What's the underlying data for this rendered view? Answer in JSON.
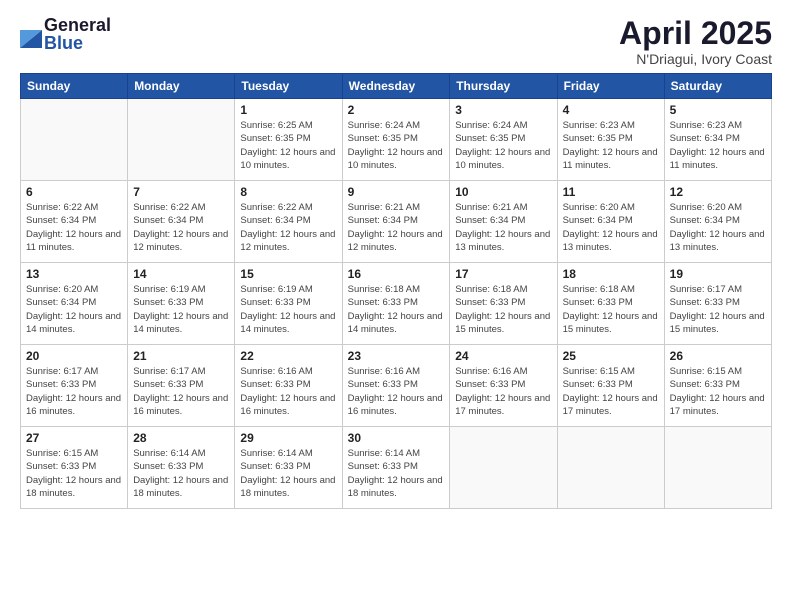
{
  "logo": {
    "general": "General",
    "blue": "Blue"
  },
  "header": {
    "title": "April 2025",
    "subtitle": "N'Driagui, Ivory Coast"
  },
  "weekdays": [
    "Sunday",
    "Monday",
    "Tuesday",
    "Wednesday",
    "Thursday",
    "Friday",
    "Saturday"
  ],
  "weeks": [
    [
      {
        "day": "",
        "info": ""
      },
      {
        "day": "",
        "info": ""
      },
      {
        "day": "1",
        "info": "Sunrise: 6:25 AM\nSunset: 6:35 PM\nDaylight: 12 hours and 10 minutes."
      },
      {
        "day": "2",
        "info": "Sunrise: 6:24 AM\nSunset: 6:35 PM\nDaylight: 12 hours and 10 minutes."
      },
      {
        "day": "3",
        "info": "Sunrise: 6:24 AM\nSunset: 6:35 PM\nDaylight: 12 hours and 10 minutes."
      },
      {
        "day": "4",
        "info": "Sunrise: 6:23 AM\nSunset: 6:35 PM\nDaylight: 12 hours and 11 minutes."
      },
      {
        "day": "5",
        "info": "Sunrise: 6:23 AM\nSunset: 6:34 PM\nDaylight: 12 hours and 11 minutes."
      }
    ],
    [
      {
        "day": "6",
        "info": "Sunrise: 6:22 AM\nSunset: 6:34 PM\nDaylight: 12 hours and 11 minutes."
      },
      {
        "day": "7",
        "info": "Sunrise: 6:22 AM\nSunset: 6:34 PM\nDaylight: 12 hours and 12 minutes."
      },
      {
        "day": "8",
        "info": "Sunrise: 6:22 AM\nSunset: 6:34 PM\nDaylight: 12 hours and 12 minutes."
      },
      {
        "day": "9",
        "info": "Sunrise: 6:21 AM\nSunset: 6:34 PM\nDaylight: 12 hours and 12 minutes."
      },
      {
        "day": "10",
        "info": "Sunrise: 6:21 AM\nSunset: 6:34 PM\nDaylight: 12 hours and 13 minutes."
      },
      {
        "day": "11",
        "info": "Sunrise: 6:20 AM\nSunset: 6:34 PM\nDaylight: 12 hours and 13 minutes."
      },
      {
        "day": "12",
        "info": "Sunrise: 6:20 AM\nSunset: 6:34 PM\nDaylight: 12 hours and 13 minutes."
      }
    ],
    [
      {
        "day": "13",
        "info": "Sunrise: 6:20 AM\nSunset: 6:34 PM\nDaylight: 12 hours and 14 minutes."
      },
      {
        "day": "14",
        "info": "Sunrise: 6:19 AM\nSunset: 6:33 PM\nDaylight: 12 hours and 14 minutes."
      },
      {
        "day": "15",
        "info": "Sunrise: 6:19 AM\nSunset: 6:33 PM\nDaylight: 12 hours and 14 minutes."
      },
      {
        "day": "16",
        "info": "Sunrise: 6:18 AM\nSunset: 6:33 PM\nDaylight: 12 hours and 14 minutes."
      },
      {
        "day": "17",
        "info": "Sunrise: 6:18 AM\nSunset: 6:33 PM\nDaylight: 12 hours and 15 minutes."
      },
      {
        "day": "18",
        "info": "Sunrise: 6:18 AM\nSunset: 6:33 PM\nDaylight: 12 hours and 15 minutes."
      },
      {
        "day": "19",
        "info": "Sunrise: 6:17 AM\nSunset: 6:33 PM\nDaylight: 12 hours and 15 minutes."
      }
    ],
    [
      {
        "day": "20",
        "info": "Sunrise: 6:17 AM\nSunset: 6:33 PM\nDaylight: 12 hours and 16 minutes."
      },
      {
        "day": "21",
        "info": "Sunrise: 6:17 AM\nSunset: 6:33 PM\nDaylight: 12 hours and 16 minutes."
      },
      {
        "day": "22",
        "info": "Sunrise: 6:16 AM\nSunset: 6:33 PM\nDaylight: 12 hours and 16 minutes."
      },
      {
        "day": "23",
        "info": "Sunrise: 6:16 AM\nSunset: 6:33 PM\nDaylight: 12 hours and 16 minutes."
      },
      {
        "day": "24",
        "info": "Sunrise: 6:16 AM\nSunset: 6:33 PM\nDaylight: 12 hours and 17 minutes."
      },
      {
        "day": "25",
        "info": "Sunrise: 6:15 AM\nSunset: 6:33 PM\nDaylight: 12 hours and 17 minutes."
      },
      {
        "day": "26",
        "info": "Sunrise: 6:15 AM\nSunset: 6:33 PM\nDaylight: 12 hours and 17 minutes."
      }
    ],
    [
      {
        "day": "27",
        "info": "Sunrise: 6:15 AM\nSunset: 6:33 PM\nDaylight: 12 hours and 18 minutes."
      },
      {
        "day": "28",
        "info": "Sunrise: 6:14 AM\nSunset: 6:33 PM\nDaylight: 12 hours and 18 minutes."
      },
      {
        "day": "29",
        "info": "Sunrise: 6:14 AM\nSunset: 6:33 PM\nDaylight: 12 hours and 18 minutes."
      },
      {
        "day": "30",
        "info": "Sunrise: 6:14 AM\nSunset: 6:33 PM\nDaylight: 12 hours and 18 minutes."
      },
      {
        "day": "",
        "info": ""
      },
      {
        "day": "",
        "info": ""
      },
      {
        "day": "",
        "info": ""
      }
    ]
  ]
}
